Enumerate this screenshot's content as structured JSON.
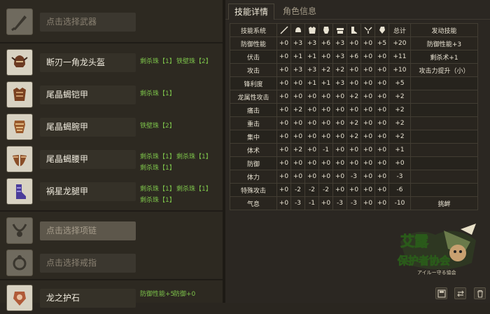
{
  "slots": {
    "weapon": {
      "label": "点击选择武器",
      "icon": "weapon-slot-icon"
    },
    "head": {
      "label": "断刃一角龙头盔",
      "icon": "helmet-icon",
      "jewels": [
        "剩杀珠【1】",
        "铁壁珠【2】"
      ]
    },
    "chest": {
      "label": "尾晶蝎铠甲",
      "icon": "chest-armor-icon",
      "jewels": [
        "剩杀珠【1】"
      ]
    },
    "arms": {
      "label": "尾晶蝎腕甲",
      "icon": "arm-armor-icon",
      "jewels": [
        "铁壁珠【2】"
      ]
    },
    "waist": {
      "label": "尾晶蝎腰甲",
      "icon": "waist-armor-icon",
      "jewels": [
        "剩杀珠【1】",
        "剩杀珠【1】",
        "剩杀珠【1】"
      ]
    },
    "legs": {
      "label": "祸星龙腿甲",
      "icon": "leg-armor-icon",
      "jewels": [
        "剩杀珠【1】",
        "剩杀珠【1】",
        "剩杀珠【1】"
      ]
    },
    "necklace": {
      "label": "点击选择项链",
      "icon": "necklace-icon"
    },
    "ring": {
      "label": "点击选择戒指",
      "icon": "ring-icon"
    },
    "charm": {
      "label": "龙之护石",
      "icon": "charm-icon",
      "jewels": [
        "防御性能+5",
        "防御+0"
      ]
    }
  },
  "tabs": {
    "active": "技能详情",
    "inactive": "角色信息"
  },
  "table": {
    "h_skill": "技能系统",
    "h_total": "总计",
    "h_active": "发动技能",
    "rows": [
      {
        "name": "防御性能",
        "v": [
          "+0",
          "+3",
          "+3",
          "+6",
          "+3",
          "+0",
          "+0",
          "+5"
        ],
        "total": "+20",
        "active": "防御性能+3"
      },
      {
        "name": "伏击",
        "v": [
          "+0",
          "+1",
          "+1",
          "+0",
          "+3",
          "+6",
          "+0",
          "+0"
        ],
        "total": "+11",
        "active": "剩杀术+1"
      },
      {
        "name": "攻击",
        "v": [
          "+0",
          "+3",
          "+3",
          "+2",
          "+2",
          "+0",
          "+0",
          "+0"
        ],
        "total": "+10",
        "active": "攻击力提升（小）"
      },
      {
        "name": "锋利度",
        "v": [
          "+0",
          "+0",
          "+1",
          "+1",
          "+3",
          "+0",
          "+0",
          "+0"
        ],
        "total": "+5",
        "active": ""
      },
      {
        "name": "龙属性攻击",
        "v": [
          "+0",
          "+0",
          "+0",
          "+0",
          "+0",
          "+2",
          "+0",
          "+0"
        ],
        "total": "+2",
        "active": ""
      },
      {
        "name": "痛击",
        "v": [
          "+0",
          "+2",
          "+0",
          "+0",
          "+0",
          "+0",
          "+0",
          "+0"
        ],
        "total": "+2",
        "active": ""
      },
      {
        "name": "重击",
        "v": [
          "+0",
          "+0",
          "+0",
          "+0",
          "+0",
          "+2",
          "+0",
          "+0"
        ],
        "total": "+2",
        "active": ""
      },
      {
        "name": "集中",
        "v": [
          "+0",
          "+0",
          "+0",
          "+0",
          "+0",
          "+2",
          "+0",
          "+0"
        ],
        "total": "+2",
        "active": ""
      },
      {
        "name": "体术",
        "v": [
          "+0",
          "+2",
          "+0",
          "-1",
          "+0",
          "+0",
          "+0",
          "+0"
        ],
        "total": "+1",
        "active": ""
      },
      {
        "name": "防御",
        "v": [
          "+0",
          "+0",
          "+0",
          "+0",
          "+0",
          "+0",
          "+0",
          "+0"
        ],
        "total": "+0",
        "active": ""
      },
      {
        "name": "体力",
        "v": [
          "+0",
          "+0",
          "+0",
          "+0",
          "+0",
          "-3",
          "+0",
          "+0"
        ],
        "total": "-3",
        "active": ""
      },
      {
        "name": "特殊攻击",
        "v": [
          "+0",
          "-2",
          "-2",
          "-2",
          "+0",
          "+0",
          "+0",
          "+0"
        ],
        "total": "-6",
        "active": ""
      },
      {
        "name": "气息",
        "v": [
          "+0",
          "-3",
          "-1",
          "+0",
          "-3",
          "-3",
          "+0",
          "+0"
        ],
        "total": "-10",
        "active": "挑衅"
      }
    ]
  },
  "logo": {
    "line1": "艾露",
    "line2": "保护者协会",
    "sub": "アイルー守る協会"
  }
}
